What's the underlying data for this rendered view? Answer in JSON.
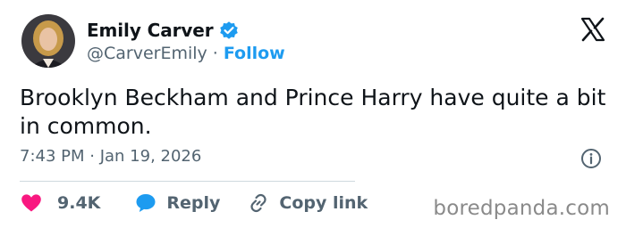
{
  "author": {
    "display_name": "Emily Carver",
    "handle": "@CarverEmily",
    "separator": "·",
    "follow_label": "Follow"
  },
  "tweet": {
    "text": "Brooklyn Beckham and Prince Harry have quite a bit in common.",
    "timestamp": "7:43 PM · Jan 19, 2026"
  },
  "actions": {
    "like_count": "9.4K",
    "reply_label": "Reply",
    "copy_link_label": "Copy link"
  },
  "watermark": "boredpanda.com",
  "icons": {
    "verified": "verified-badge-icon",
    "logo": "x-logo-icon",
    "info": "info-icon",
    "like": "heart-icon",
    "reply": "speech-bubble-icon",
    "copy": "link-icon"
  },
  "colors": {
    "accent_blue": "#1d9bf0",
    "like_red": "#f91880",
    "text_primary": "#0f1419",
    "text_secondary": "#536471",
    "divider": "#cfd9de"
  }
}
